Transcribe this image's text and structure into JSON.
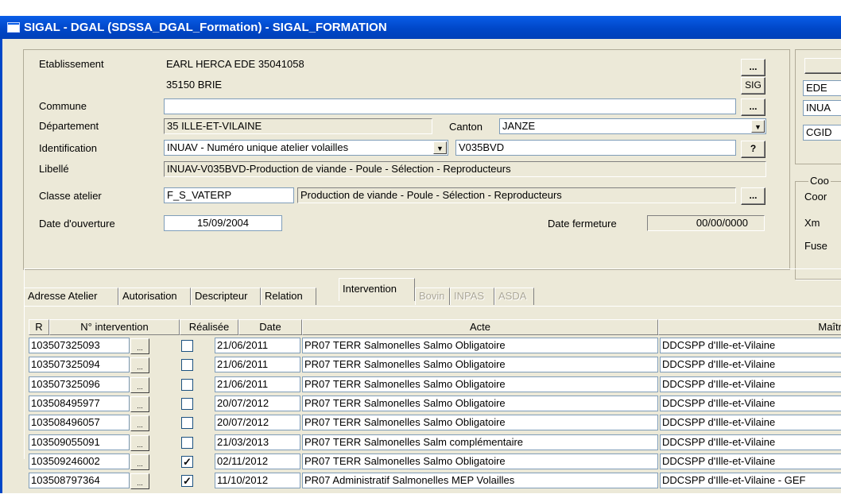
{
  "window": {
    "title": "SIGAL - DGAL (SDSSA_DGAL_Formation) - SIGAL_FORMATION"
  },
  "etablissement": {
    "label": "Etablissement",
    "line1": "EARL HERCA EDE 35041058",
    "line2": "35150 BRIE",
    "browse_label": "...",
    "sig_label": "SIG"
  },
  "commune": {
    "label": "Commune",
    "value": "",
    "browse_label": "..."
  },
  "departement": {
    "label": "Département",
    "value": "35 ILLE-ET-VILAINE"
  },
  "canton": {
    "label": "Canton",
    "value": "JANZE"
  },
  "identification": {
    "label": "Identification",
    "type": "INUAV - Numéro unique atelier volailles",
    "value": "V035BVD",
    "help_label": "?"
  },
  "libelle": {
    "label": "Libellé",
    "value": "INUAV-V035BVD-Production de viande - Poule - Sélection - Reproducteurs"
  },
  "classe": {
    "label": "Classe atelier",
    "code": "F_S_VATERP",
    "description": "Production de viande - Poule - Sélection - Reproducteurs",
    "browse_label": "..."
  },
  "date_ouverture": {
    "label": "Date d'ouverture",
    "value": "15/09/2004"
  },
  "date_fermeture": {
    "label": "Date fermeture",
    "value": "00/00/0000"
  },
  "right_panel": {
    "fields": [
      "EDE",
      "INUA",
      "CGID"
    ],
    "coord_group": "Coo",
    "coord_label": "Coor",
    "xm_label": "Xm",
    "fuse_label": "Fuse"
  },
  "tabs": [
    {
      "label": "Adresse Atelier",
      "state": "normal"
    },
    {
      "label": "Autorisation",
      "state": "normal"
    },
    {
      "label": "Descripteur",
      "state": "normal"
    },
    {
      "label": "Relation",
      "state": "normal"
    },
    {
      "label": "Intervention",
      "state": "active"
    },
    {
      "label": "Bovin",
      "state": "disabled"
    },
    {
      "label": "INPAS",
      "state": "disabled"
    },
    {
      "label": "ASDA",
      "state": "disabled"
    }
  ],
  "grid": {
    "columns": {
      "r": "R",
      "num": "N° intervention",
      "realisee": "Réalisée",
      "date": "Date",
      "acte": "Acte",
      "maitre": "Maîtr"
    },
    "ellipsis": "...",
    "rows": [
      {
        "num": "103507325093",
        "realisee": false,
        "date": "21/06/2011",
        "acte": "PR07  TERR Salmonelles Salmo Obligatoire",
        "maitre": "DDCSPP d'Ille-et-Vilaine"
      },
      {
        "num": "103507325094",
        "realisee": false,
        "date": "21/06/2011",
        "acte": "PR07  TERR Salmonelles Salmo Obligatoire",
        "maitre": "DDCSPP d'Ille-et-Vilaine"
      },
      {
        "num": "103507325096",
        "realisee": false,
        "date": "21/06/2011",
        "acte": "PR07  TERR Salmonelles Salmo Obligatoire",
        "maitre": "DDCSPP d'Ille-et-Vilaine"
      },
      {
        "num": "103508495977",
        "realisee": false,
        "date": "20/07/2012",
        "acte": "PR07  TERR Salmonelles Salmo Obligatoire",
        "maitre": "DDCSPP d'Ille-et-Vilaine"
      },
      {
        "num": "103508496057",
        "realisee": false,
        "date": "20/07/2012",
        "acte": "PR07  TERR Salmonelles Salmo Obligatoire",
        "maitre": "DDCSPP d'Ille-et-Vilaine"
      },
      {
        "num": "103509055091",
        "realisee": false,
        "date": "21/03/2013",
        "acte": "PR07  TERR Salmonelles Salm complémentaire",
        "maitre": "DDCSPP d'Ille-et-Vilaine"
      },
      {
        "num": "103509246002",
        "realisee": true,
        "date": "02/11/2012",
        "acte": "PR07  TERR Salmonelles Salmo Obligatoire",
        "maitre": "DDCSPP d'Ille-et-Vilaine"
      },
      {
        "num": "103508797364",
        "realisee": true,
        "date": "11/10/2012",
        "acte": "PR07  Administratif Salmonelles MEP Volailles",
        "maitre": "DDCSPP d'Ille-et-Vilaine - GEF"
      }
    ]
  }
}
